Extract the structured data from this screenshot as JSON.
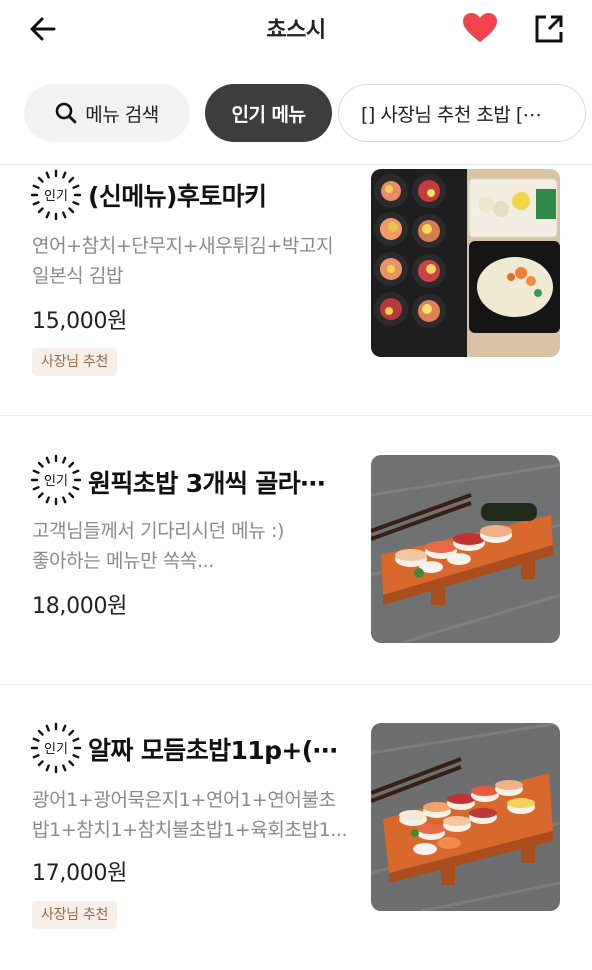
{
  "header": {
    "title": "쵸스시",
    "back_icon": "arrow-left-icon",
    "favorite_icon": "heart-icon",
    "favorite_color": "#f0434b",
    "share_icon": "share-external-icon"
  },
  "filters": {
    "search_label": "메뉴 검색",
    "popular_label": "인기 메뉴",
    "owner_pick_label": "[] 사장님 추천 초밥 [⋯",
    "active": "인기 메뉴"
  },
  "badge_text": "인기",
  "items": [
    {
      "name": "(신메뉴)후토마키",
      "desc": [
        "연어+참치+단무지+새우튀김+박고지",
        "일본식 김밥"
      ],
      "price": "15,000원",
      "tag": "사장님 추천",
      "image": "futomaki-photo"
    },
    {
      "name": "원픽초밥 3개씩 골라⋯",
      "desc": [
        "고객님들께서 기다리시던 메뉴 :)",
        "좋아하는 메뉴만 쏙쏙..."
      ],
      "price": "18,000원",
      "tag": "",
      "image": "sushi-board-photo"
    },
    {
      "name": "알짜 모듬초밥11p+(⋯",
      "desc": [
        "광어1+광어묵은지1+연어1+연어불초",
        "밥1+참치1+참치불초밥1+육회초밥1..."
      ],
      "price": "17,000원",
      "tag": "사장님 추천",
      "image": "assorted-sushi-photo"
    }
  ],
  "colors": {
    "chip_active_bg": "#3d3d3d",
    "tag_bg": "#f6efe8",
    "tag_text": "#9b6a48",
    "desc_text": "#8a8a8a"
  }
}
